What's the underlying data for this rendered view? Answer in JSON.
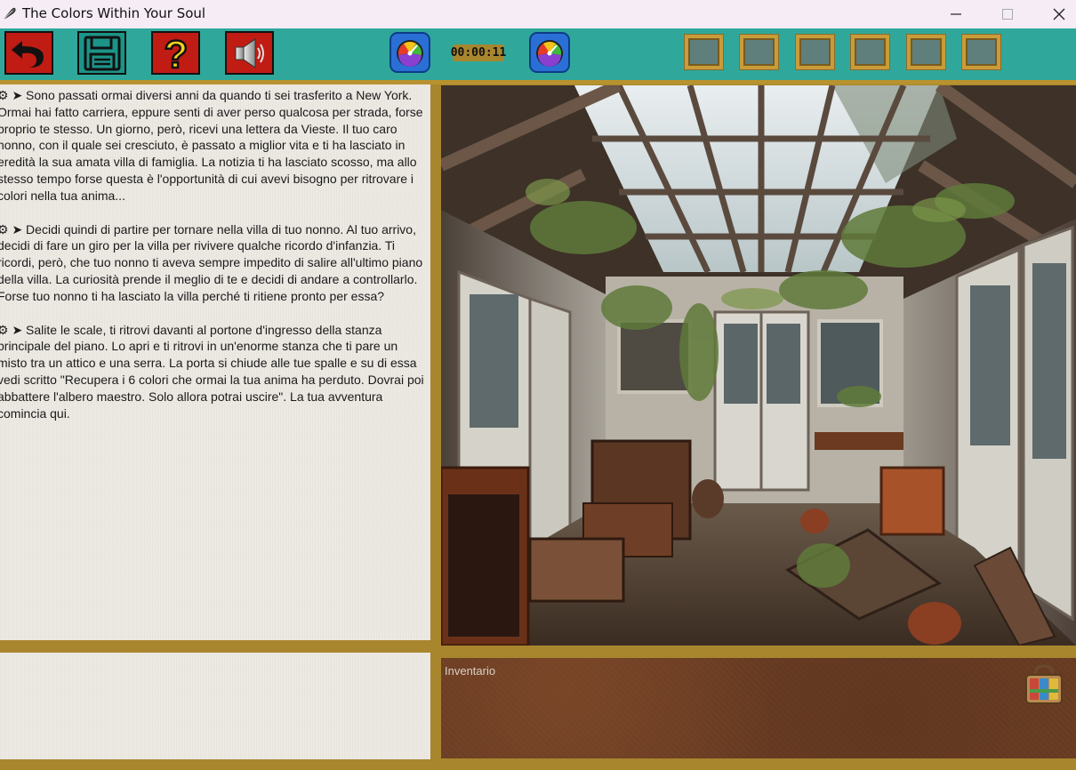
{
  "window": {
    "title": "The Colors Within Your Soul",
    "minimize_icon": "minimize-icon",
    "maximize_icon": "maximize-icon",
    "close_icon": "close-icon"
  },
  "toolbar": {
    "buttons": [
      {
        "name": "back-button",
        "icon": "undo-arrow-icon",
        "color": "#c01c14"
      },
      {
        "name": "save-button",
        "icon": "floppy-disk-icon",
        "color": "#1c9488"
      },
      {
        "name": "help-button",
        "icon": "question-mark-icon",
        "color": "#c01c14"
      },
      {
        "name": "sound-button",
        "icon": "speaker-icon",
        "color": "#c01c14"
      }
    ],
    "timer": "00:00:11",
    "color_slots": 6,
    "accent": "#2fa89b",
    "frame_color": "#a8862e"
  },
  "story": {
    "paragraphs": [
      "⚙ ➤ Sono passati ormai diversi anni da quando ti sei trasferito a New York. Ormai hai fatto carriera, eppure senti di aver perso qualcosa per strada, forse proprio te stesso. Un giorno, però, ricevi una lettera da Vieste. Il tuo caro nonno, con il quale sei cresciuto, è passato a miglior vita e ti ha lasciato in eredità la sua amata villa di famiglia. La notizia ti ha lasciato scosso, ma allo stesso tempo forse questa è l'opportunità di cui avevi bisogno per ritrovare i colori nella tua anima...",
      "⚙ ➤ Decidi quindi di partire per tornare nella villa di tuo nonno. Al tuo arrivo, decidi di fare un giro per la villa per rivivere qualche ricordo d'infanzia. Ti ricordi, però, che tuo nonno ti aveva sempre impedito di salire all'ultimo piano della villa. La curiosità prende il meglio di te e decidi di andare a controllarlo. Forse tuo nonno ti ha lasciato la villa perché ti ritiene pronto per essa?",
      "⚙ ➤ Salite le scale, ti ritrovi davanti al portone d'ingresso della stanza principale del piano. Lo apri e ti ritrovi in un'enorme stanza che ti pare un misto tra un attico e una serra. La porta si chiude alle tue spalle e su di essa vedi scritto \"Recupera i 6 colori che ormai la tua anima ha perduto. Dovrai poi abbattere l'albero maestro. Solo allora potrai uscire\". La tua avventura comincia qui."
    ]
  },
  "inventory": {
    "label": "Inventario",
    "items": [
      "bag-icon"
    ]
  }
}
